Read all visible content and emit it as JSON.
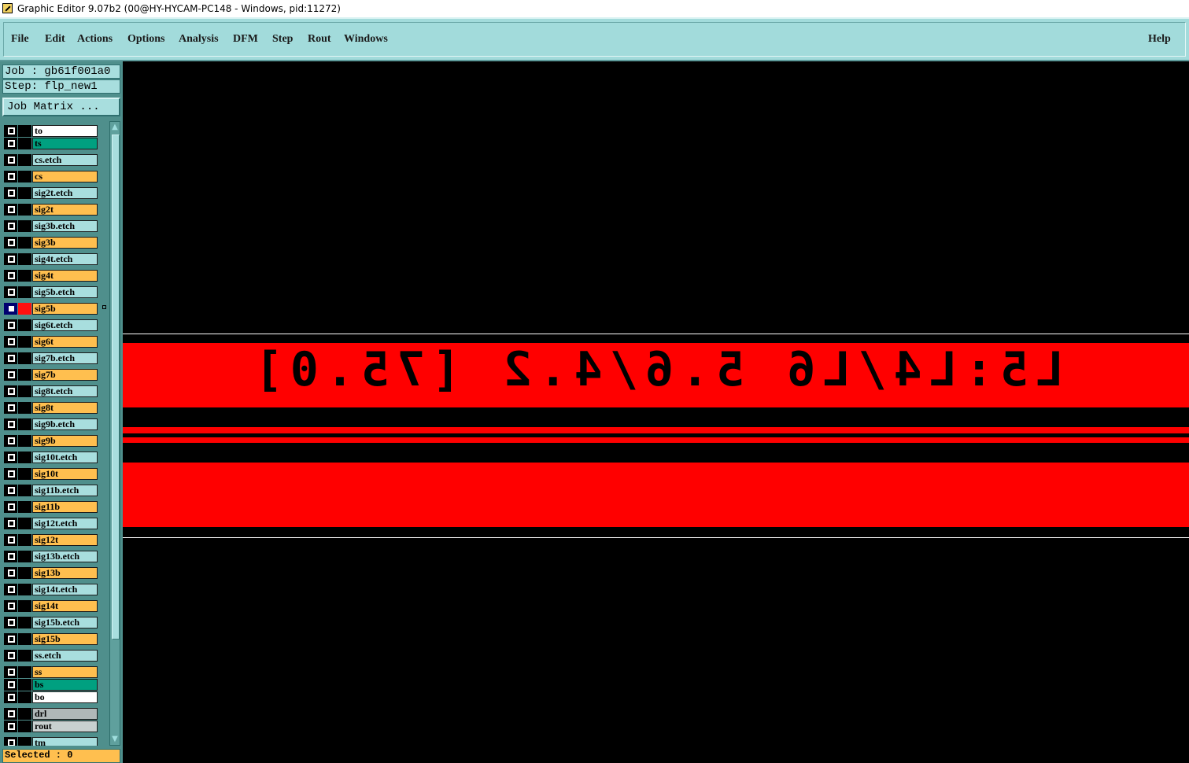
{
  "window": {
    "title": "Graphic Editor 9.07b2 (00@HY-HYCAM-PC148 - Windows, pid:11272)",
    "icon": "app-editor-icon"
  },
  "menu": {
    "items": [
      "File",
      "Edit",
      "Actions",
      "Options",
      "Analysis",
      "DFM",
      "Step",
      "Rout",
      "Windows"
    ],
    "help": "Help"
  },
  "job": {
    "job_line": "Job : gb61f001a0",
    "step_line": "Step: flp_new1",
    "matrix_button": "Job Matrix ..."
  },
  "layers": [
    {
      "name": "to",
      "color": "#ffffff"
    },
    {
      "name": "ts",
      "color": "#00a080"
    },
    {
      "name": "cs.etch",
      "color": "#a8dede"
    },
    {
      "name": "cs",
      "color": "#ffbf4f"
    },
    {
      "name": "sig2t.etch",
      "color": "#a8dede"
    },
    {
      "name": "sig2t",
      "color": "#ffbf4f"
    },
    {
      "name": "sig3b.etch",
      "color": "#a8dede"
    },
    {
      "name": "sig3b",
      "color": "#ffbf4f"
    },
    {
      "name": "sig4t.etch",
      "color": "#a8dede"
    },
    {
      "name": "sig4t",
      "color": "#ffbf4f"
    },
    {
      "name": "sig5b.etch",
      "color": "#a8dede"
    },
    {
      "name": "sig5b",
      "color": "#ffbf4f",
      "active": true
    },
    {
      "name": "sig6t.etch",
      "color": "#a8dede"
    },
    {
      "name": "sig6t",
      "color": "#ffbf4f"
    },
    {
      "name": "sig7b.etch",
      "color": "#a8dede"
    },
    {
      "name": "sig7b",
      "color": "#ffbf4f"
    },
    {
      "name": "sig8t.etch",
      "color": "#a8dede"
    },
    {
      "name": "sig8t",
      "color": "#ffbf4f"
    },
    {
      "name": "sig9b.etch",
      "color": "#a8dede"
    },
    {
      "name": "sig9b",
      "color": "#ffbf4f"
    },
    {
      "name": "sig10t.etch",
      "color": "#a8dede"
    },
    {
      "name": "sig10t",
      "color": "#ffbf4f"
    },
    {
      "name": "sig11b.etch",
      "color": "#a8dede"
    },
    {
      "name": "sig11b",
      "color": "#ffbf4f"
    },
    {
      "name": "sig12t.etch",
      "color": "#a8dede"
    },
    {
      "name": "sig12t",
      "color": "#ffbf4f"
    },
    {
      "name": "sig13b.etch",
      "color": "#a8dede"
    },
    {
      "name": "sig13b",
      "color": "#ffbf4f"
    },
    {
      "name": "sig14t.etch",
      "color": "#a8dede"
    },
    {
      "name": "sig14t",
      "color": "#ffbf4f"
    },
    {
      "name": "sig15b.etch",
      "color": "#a8dede"
    },
    {
      "name": "sig15b",
      "color": "#ffbf4f"
    },
    {
      "name": "ss.etch",
      "color": "#a8dede"
    },
    {
      "name": "ss",
      "color": "#ffbf4f"
    },
    {
      "name": "bs",
      "color": "#00a080"
    },
    {
      "name": "bo",
      "color": "#ffffff"
    },
    {
      "name": "drl",
      "color": "#b0b8b8"
    },
    {
      "name": "rout",
      "color": "#c8d0d0"
    },
    {
      "name": "tm",
      "color": "#a8dede"
    }
  ],
  "status": {
    "selected": "Selected : 0"
  },
  "canvas": {
    "label_text": "L5:L4/L6 5.6/4.2 [75.0]",
    "background": "#000000",
    "feature_color": "#ff0000"
  }
}
